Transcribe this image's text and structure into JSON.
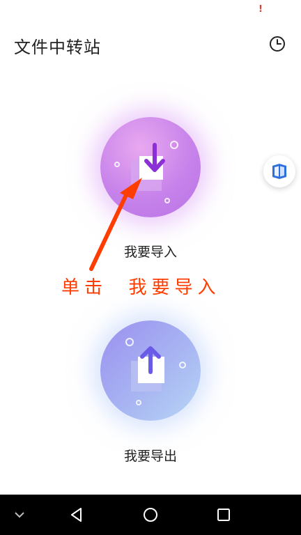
{
  "status_bar": {
    "alert_glyph": "!"
  },
  "header": {
    "title": "文件中转站",
    "history_icon": "clock-icon"
  },
  "floating_button": {
    "icon": "cube-icon"
  },
  "options": [
    {
      "label": "我要导入",
      "icon": "download-tray-icon"
    },
    {
      "label": "我要导出",
      "icon": "upload-tray-icon"
    }
  ],
  "annotation": {
    "text": "单击  我要导入",
    "color": "#ff3d00"
  },
  "nav_bar": {
    "items": [
      "chevron-down-icon",
      "back-triangle-icon",
      "home-circle-icon",
      "recents-square-icon"
    ]
  },
  "colors": {
    "import_circle": "#c783ea",
    "import_arrow": "#8b2fd6",
    "export_circle": "#a9b8f2",
    "export_arrow": "#6a5ae8",
    "annotation": "#ff3d00"
  }
}
